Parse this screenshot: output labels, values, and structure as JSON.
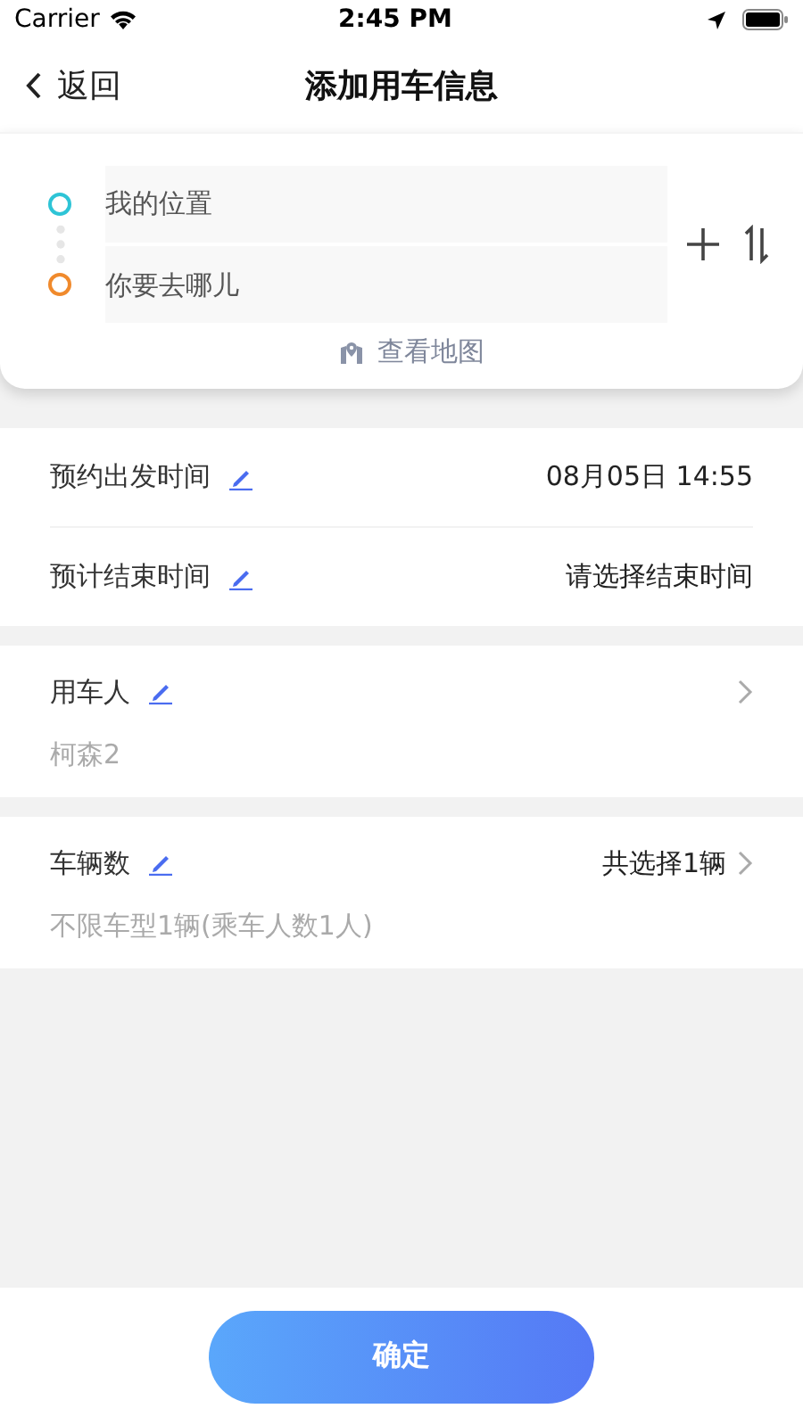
{
  "status_bar": {
    "carrier": "Carrier",
    "time": "2:45 PM"
  },
  "nav": {
    "back": "返回",
    "title": "添加用车信息"
  },
  "route": {
    "stops": [
      {
        "kind": "origin",
        "value": "我的位置",
        "color": "#2ec4d6"
      },
      {
        "kind": "destination",
        "placeholder": "你要去哪儿",
        "color": "#f08a2c"
      }
    ],
    "map_link": "查看地图"
  },
  "time_rows": [
    {
      "label": "预约出发时间",
      "value": "08月05日 14:55"
    },
    {
      "label": "预计结束时间",
      "value": "请选择结束时间"
    }
  ],
  "sections": [
    {
      "label": "用车人",
      "detail": "柯森2"
    },
    {
      "label": "车辆数",
      "summary": "共选择1辆",
      "detail": "不限车型1辆(乘车人数1人)"
    }
  ],
  "confirm_button": "确定"
}
